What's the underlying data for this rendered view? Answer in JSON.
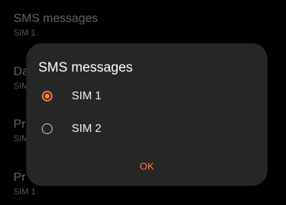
{
  "background": {
    "items": [
      {
        "title": "SMS messages",
        "subtitle": "SIM 1"
      },
      {
        "title": "Da",
        "subtitle": "SIM"
      },
      {
        "title": "Pr",
        "subtitle": "SIM"
      },
      {
        "title": "Pr",
        "subtitle": "SIM 1"
      }
    ]
  },
  "dialog": {
    "title": "SMS messages",
    "options": [
      {
        "label": "SIM 1",
        "selected": true
      },
      {
        "label": "SIM 2",
        "selected": false
      }
    ],
    "ok_label": "OK"
  },
  "colors": {
    "accent": "#ff7f3f",
    "dialog_bg": "#262626",
    "screen_bg": "#000000"
  }
}
